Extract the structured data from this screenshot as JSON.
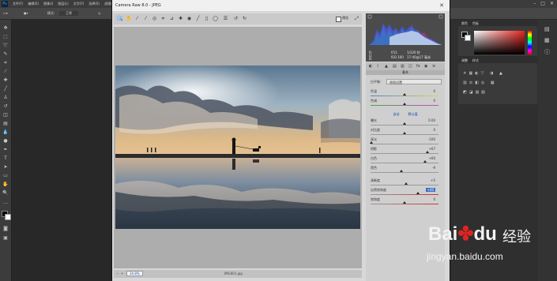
{
  "photoshop": {
    "logo": "Ps",
    "menus": [
      "文件(F)",
      "编辑(E)",
      "图像(I)",
      "图层(L)",
      "文字(Y)",
      "选择(S)",
      "滤镜(T)",
      "3D(D)",
      "视图(V)",
      "窗口(W)",
      "帮助(H)"
    ],
    "options": {
      "mode_label": "模式:",
      "mode_value": "正常"
    },
    "color_panel_tabs": [
      "颜色",
      "色板"
    ],
    "adjust_panel_tabs": [
      "调整",
      "样式"
    ]
  },
  "camera_raw": {
    "title": "Camera Raw 8.0 - JPEG",
    "preview_label": "预览",
    "zoom_value": "34.8%",
    "filename": "IMG001.jpg",
    "camera_info": {
      "row1": [
        "f/11",
        "1/320 秒"
      ],
      "row2": [
        "ISO 100",
        "17-40@17 毫米"
      ],
      "rgb": [
        "R:",
        "G:",
        "B:"
      ]
    },
    "panel_title": "基本",
    "white_balance": {
      "label": "白平衡:",
      "value": "原照设置"
    },
    "temp": {
      "label": "色温",
      "value": "0"
    },
    "tint": {
      "label": "色调",
      "value": "0"
    },
    "auto_label": "自动",
    "default_label": "默认值",
    "exposure": {
      "label": "曝光",
      "value": "0.00"
    },
    "contrast": {
      "label": "对比度",
      "value": "0"
    },
    "highlights": {
      "label": "高光",
      "value": "-100"
    },
    "shadows": {
      "label": "阴影",
      "value": "+67"
    },
    "whites": {
      "label": "白色",
      "value": "+60"
    },
    "blacks": {
      "label": "黑色",
      "value": "-9"
    },
    "clarity": {
      "label": "清晰度",
      "value": "+5"
    },
    "vibrance": {
      "label": "自然饱和度",
      "value": "+40"
    },
    "saturation": {
      "label": "饱和度",
      "value": "0"
    }
  },
  "watermark": {
    "brand": "Bai",
    "brand2": "du",
    "cn": "经验",
    "url": "jingyan.baidu.com"
  },
  "colors": {
    "ps_dark": "#2b2b2b",
    "dialog_bg": "#d8d8d8",
    "link_blue": "#0a47a8",
    "baidu_red": "#de2421"
  }
}
